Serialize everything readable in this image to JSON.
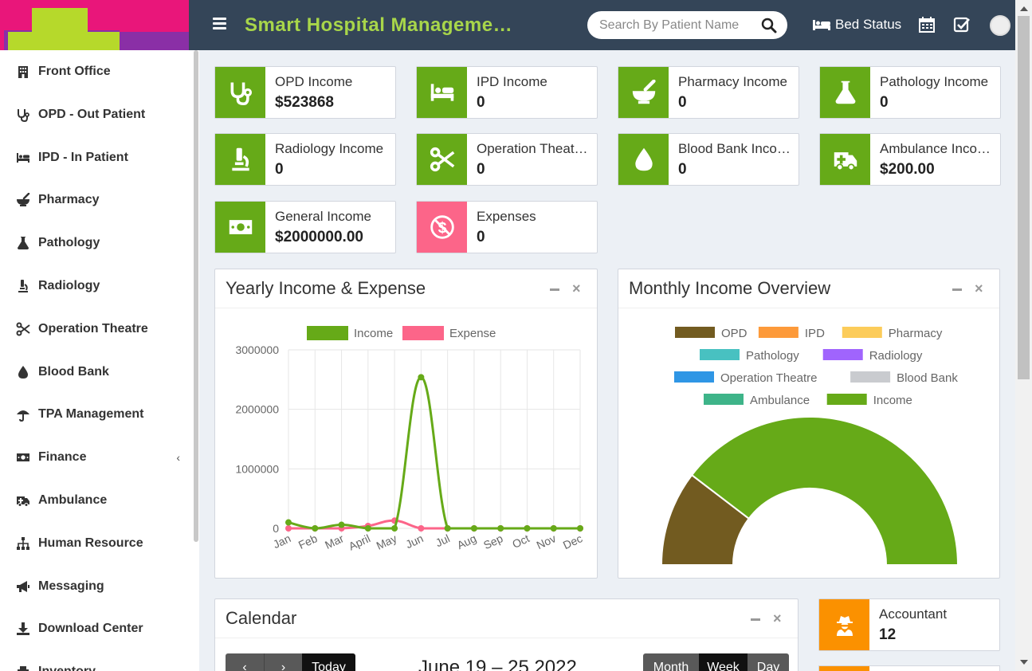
{
  "header": {
    "app_title": "Smart Hospital Management System",
    "search_placeholder": "Search By Patient Name",
    "bed_status": "Bed Status"
  },
  "sidebar": {
    "items": [
      {
        "label": "Front Office",
        "icon": "building-icon"
      },
      {
        "label": "OPD - Out Patient",
        "icon": "stethoscope-icon"
      },
      {
        "label": "IPD - In Patient",
        "icon": "bed-icon"
      },
      {
        "label": "Pharmacy",
        "icon": "mortar-pestle-icon"
      },
      {
        "label": "Pathology",
        "icon": "flask-icon"
      },
      {
        "label": "Radiology",
        "icon": "microscope-icon"
      },
      {
        "label": "Operation Theatre",
        "icon": "scissors-icon"
      },
      {
        "label": "Blood Bank",
        "icon": "droplet-icon"
      },
      {
        "label": "TPA Management",
        "icon": "umbrella-icon"
      },
      {
        "label": "Finance",
        "icon": "money-icon"
      },
      {
        "label": "Ambulance",
        "icon": "ambulance-icon"
      },
      {
        "label": "Human Resource",
        "icon": "sitemap-icon"
      },
      {
        "label": "Messaging",
        "icon": "bullhorn-icon"
      },
      {
        "label": "Download Center",
        "icon": "download-icon"
      },
      {
        "label": "Inventory",
        "icon": "inventory-icon"
      }
    ]
  },
  "cards": [
    {
      "label": "OPD Income",
      "value": "$523868",
      "icon": "stethoscope-icon",
      "color": "#66aa18"
    },
    {
      "label": "IPD Income",
      "value": "0",
      "icon": "bed-icon",
      "color": "#66aa18"
    },
    {
      "label": "Pharmacy Income",
      "value": "0",
      "icon": "mortar-pestle-icon",
      "color": "#66aa18"
    },
    {
      "label": "Pathology Income",
      "value": "0",
      "icon": "flask-icon",
      "color": "#66aa18"
    },
    {
      "label": "Radiology Income",
      "value": "0",
      "icon": "microscope-icon",
      "color": "#66aa18"
    },
    {
      "label": "Operation Theatre Income",
      "value": "0",
      "icon": "scissors-icon",
      "color": "#66aa18"
    },
    {
      "label": "Blood Bank Income",
      "value": "0",
      "icon": "droplet-icon",
      "color": "#66aa18"
    },
    {
      "label": "Ambulance Income",
      "value": "$200.00",
      "icon": "ambulance-icon",
      "color": "#66aa18"
    },
    {
      "label": "General Income",
      "value": "$2000000.00",
      "icon": "money-icon",
      "color": "#66aa18"
    },
    {
      "label": "Expenses",
      "value": "0",
      "icon": "no-money-icon",
      "color": "#fc6589"
    }
  ],
  "yearly_panel": {
    "title": "Yearly Income & Expense"
  },
  "monthly_panel": {
    "title": "Monthly Income Overview"
  },
  "calendar": {
    "title": "Calendar",
    "today": "Today",
    "range": "June 19 – 25 2022",
    "views": [
      "Month",
      "Week",
      "Day"
    ]
  },
  "staff_card": {
    "label": "Accountant",
    "value": "12",
    "icon": "user-secret-icon",
    "color": "#fb9100"
  },
  "chart_data": [
    {
      "type": "line",
      "categories": [
        "Jan",
        "Feb",
        "Mar",
        "April",
        "May",
        "Jun",
        "Jul",
        "Aug",
        "Sep",
        "Oct",
        "Nov",
        "Dec"
      ],
      "series": [
        {
          "name": "Income",
          "color": "#66aa18",
          "values": [
            100000,
            0,
            60000,
            0,
            0,
            2540000,
            0,
            0,
            0,
            0,
            0,
            0
          ]
        },
        {
          "name": "Expense",
          "color": "#fc6589",
          "values": [
            0,
            0,
            0,
            40000,
            130000,
            0,
            0,
            0,
            0,
            0,
            0,
            0
          ]
        }
      ],
      "yticks": [
        "3000000",
        "2000000",
        "1000000",
        "0"
      ],
      "ylim": [
        0,
        3000000
      ],
      "grid": true,
      "legend": "top"
    },
    {
      "type": "pie",
      "variant": "half-doughnut",
      "legend": "top",
      "labels": [
        "OPD",
        "IPD",
        "Pharmacy",
        "Pathology",
        "Radiology",
        "Operation Theatre",
        "Blood Bank",
        "Ambulance",
        "Income"
      ],
      "colors": [
        "#725b20",
        "#fd9a3a",
        "#fccc5a",
        "#48c1c1",
        "#a064fd",
        "#2f96e5",
        "#c9cbcf",
        "#3eb489",
        "#66aa18"
      ],
      "values": [
        523868,
        0,
        0,
        0,
        0,
        0,
        0,
        200,
        2000000
      ]
    }
  ]
}
